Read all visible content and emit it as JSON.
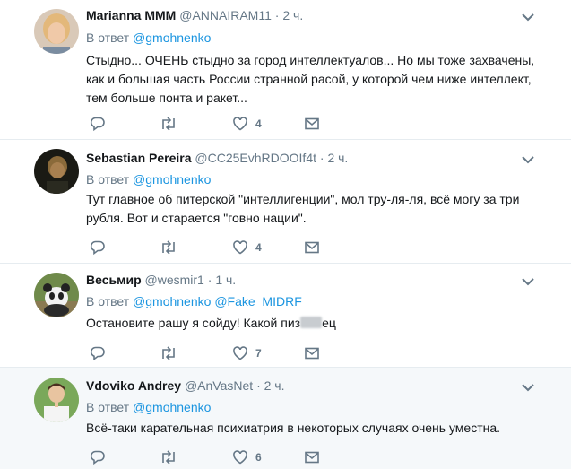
{
  "reply_prefix": "В ответ",
  "tweets": [
    {
      "name": "Marianna MMM",
      "handle": "@ANNAIRAM11",
      "dot": "·",
      "time": "2 ч.",
      "mentions": [
        "@gmohnenko"
      ],
      "text": "Стыдно... ОЧЕНЬ стыдно за город интеллектуалов... Но мы тоже захвачены, как и большая часть России странной расой, у которой чем ниже интеллект, тем больше понта и ракет...",
      "likes": "4"
    },
    {
      "name": "Sebastian Pereira",
      "handle": "@CC25EvhRDOOIf4t",
      "dot": "·",
      "time": "2 ч.",
      "mentions": [
        "@gmohnenko"
      ],
      "text": "Тут главное об питерской \"интеллигенции\", мол тру-ля-ля, всё могу за три рубля. Вот и старается \"говно нации\".",
      "likes": "4"
    },
    {
      "name": "Весьмир",
      "handle": "@wesmir1",
      "dot": "·",
      "time": "1 ч.",
      "mentions": [
        "@gmohnenko",
        "@Fake_MIDRF"
      ],
      "text_start": "Остановите рашу я сойду! Какой пиз",
      "text_end": "ец",
      "likes": "7"
    },
    {
      "name": "Vdoviko Andrey",
      "handle": "@AnVasNet",
      "dot": "·",
      "time": "2 ч.",
      "mentions": [
        "@gmohnenko"
      ],
      "text": "Всё-таки карательная психиатрия в некоторых случаях очень уместна.",
      "likes": "6"
    }
  ],
  "icons": {
    "reply": "reply-icon",
    "retweet": "retweet-icon",
    "like": "heart-icon",
    "dm": "envelope-icon",
    "more": "chevron-down-icon"
  },
  "colors": {
    "link": "#1b95e0",
    "muted": "#657786",
    "divider": "#e6ecf0",
    "highlight_bg": "#f5f8fa"
  }
}
